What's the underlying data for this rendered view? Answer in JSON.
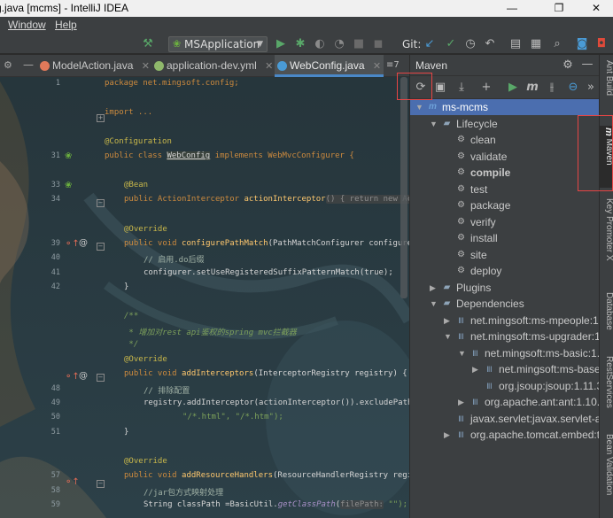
{
  "window": {
    "title": "g.java [mcms] - IntelliJ IDEA",
    "controls": {
      "minimize": "—",
      "maximize": "❐",
      "close": "✕"
    }
  },
  "menu": {
    "items": [
      "Window",
      "Help"
    ]
  },
  "toolbar": {
    "run_config": "MSApplication",
    "git_label": "Git:"
  },
  "editor_tabs": [
    {
      "label": "ModelAction.java",
      "icon": "class-icon",
      "color": "#e0795a",
      "active": false
    },
    {
      "label": "application-dev.yml",
      "icon": "yaml-icon",
      "color": "#8fb86b",
      "active": false
    },
    {
      "label": "WebConfig.java",
      "icon": "class-icon",
      "color": "#4a9bd6",
      "active": true
    }
  ],
  "tab_overflow": "≡7",
  "line_numbers": [
    "1",
    "",
    "",
    "",
    "",
    "31",
    "",
    "33",
    "34",
    "",
    "",
    "39",
    "40",
    "41",
    "42",
    "",
    "",
    "",
    "",
    "",
    "",
    "48",
    "49",
    "50",
    "51",
    "",
    "",
    "",
    "",
    "",
    "57",
    "58",
    "59"
  ],
  "code": {
    "l1": "package net.mingsoft.config;",
    "l2": "import ...",
    "l3": "@Configuration",
    "l4_a": "public class ",
    "l4_b": "WebConfig",
    "l4_c": " implements WebMvcConfigurer {",
    "l5": "@Bean",
    "l6_a": "public ActionInterceptor ",
    "l6_b": "actionInterceptor",
    "l6_c": "() { return new Act",
    "l7": "@Override",
    "l8_a": "public void ",
    "l8_b": "configurePathMatch",
    "l8_c": "(PathMatchConfigurer configurer",
    "l9": "// 启用.do后缀",
    "l10": "configurer.setUseRegisteredSuffixPatternMatch(true);",
    "l11": "}",
    "l12": "/**",
    "l13": " * 增加对rest api鉴权的spring mvc拦截器",
    "l14": " */",
    "l15": "@Override",
    "l16_a": "public void ",
    "l16_b": "addInterceptors",
    "l16_c": "(InterceptorRegistry registry) {",
    "l17": "// 排除配置",
    "l18": "registry.addInterceptor(actionInterceptor()).excludePath",
    "l19": "\"/*.html\", \"/*.htm\");",
    "l20": "}",
    "l21": "@Override",
    "l22_a": "public void ",
    "l22_b": "addResourceHandlers",
    "l22_c": "(ResourceHandlerRegistry regis",
    "l23": "//jar包方式映射处理",
    "l24_a": "String classPath =BasicUtil.",
    "l24_b": "getClassPath",
    "l24_c": "(",
    "l24_hint": "filePath:",
    "l24_d": " \"\");"
  },
  "maven": {
    "title": "Maven",
    "tree": [
      {
        "label": "ms-mcms",
        "depth": 0,
        "expanded": true,
        "icon": "maven-project-icon",
        "selected": true
      },
      {
        "label": "Lifecycle",
        "depth": 1,
        "expanded": true,
        "icon": "folder-icon"
      },
      {
        "label": "clean",
        "depth": 2,
        "icon": "gear-icon"
      },
      {
        "label": "validate",
        "depth": 2,
        "icon": "gear-icon"
      },
      {
        "label": "compile",
        "depth": 2,
        "icon": "gear-icon",
        "bold": true
      },
      {
        "label": "test",
        "depth": 2,
        "icon": "gear-icon"
      },
      {
        "label": "package",
        "depth": 2,
        "icon": "gear-icon"
      },
      {
        "label": "verify",
        "depth": 2,
        "icon": "gear-icon"
      },
      {
        "label": "install",
        "depth": 2,
        "icon": "gear-icon"
      },
      {
        "label": "site",
        "depth": 2,
        "icon": "gear-icon"
      },
      {
        "label": "deploy",
        "depth": 2,
        "icon": "gear-icon"
      },
      {
        "label": "Plugins",
        "depth": 1,
        "expanded": false,
        "icon": "folder-icon"
      },
      {
        "label": "Dependencies",
        "depth": 1,
        "expanded": true,
        "icon": "folder-icon"
      },
      {
        "label": "net.mingsoft:ms-mpeople:1.0",
        "depth": 2,
        "expanded": false,
        "icon": "library-icon"
      },
      {
        "label": "net.mingsoft:ms-upgrader:1.0",
        "depth": 2,
        "expanded": true,
        "icon": "library-icon"
      },
      {
        "label": "net.mingsoft:ms-basic:1.0.",
        "depth": 3,
        "expanded": true,
        "icon": "library-icon"
      },
      {
        "label": "net.mingsoft:ms-base:1",
        "depth": 4,
        "expanded": false,
        "icon": "library-icon"
      },
      {
        "label": "org.jsoup:jsoup:1.11.3",
        "depth": 4,
        "leaf": true,
        "icon": "library-icon"
      },
      {
        "label": "org.apache.ant:ant:1.10.5",
        "depth": 3,
        "expanded": false,
        "icon": "library-icon"
      },
      {
        "label": "javax.servlet:javax.servlet-api:",
        "depth": 2,
        "leaf": true,
        "icon": "library-icon"
      },
      {
        "label": "org.apache.tomcat.embed:to",
        "depth": 2,
        "expanded": false,
        "icon": "library-icon"
      }
    ]
  },
  "right_strip": [
    "Ant Build",
    "Maven",
    "Key Promoter X",
    "Database",
    "RestServices",
    "Bean Validation"
  ],
  "colors": {
    "accent": "#4b6eaf",
    "highlight_box": "#e64545",
    "run_green": "#59a869"
  }
}
